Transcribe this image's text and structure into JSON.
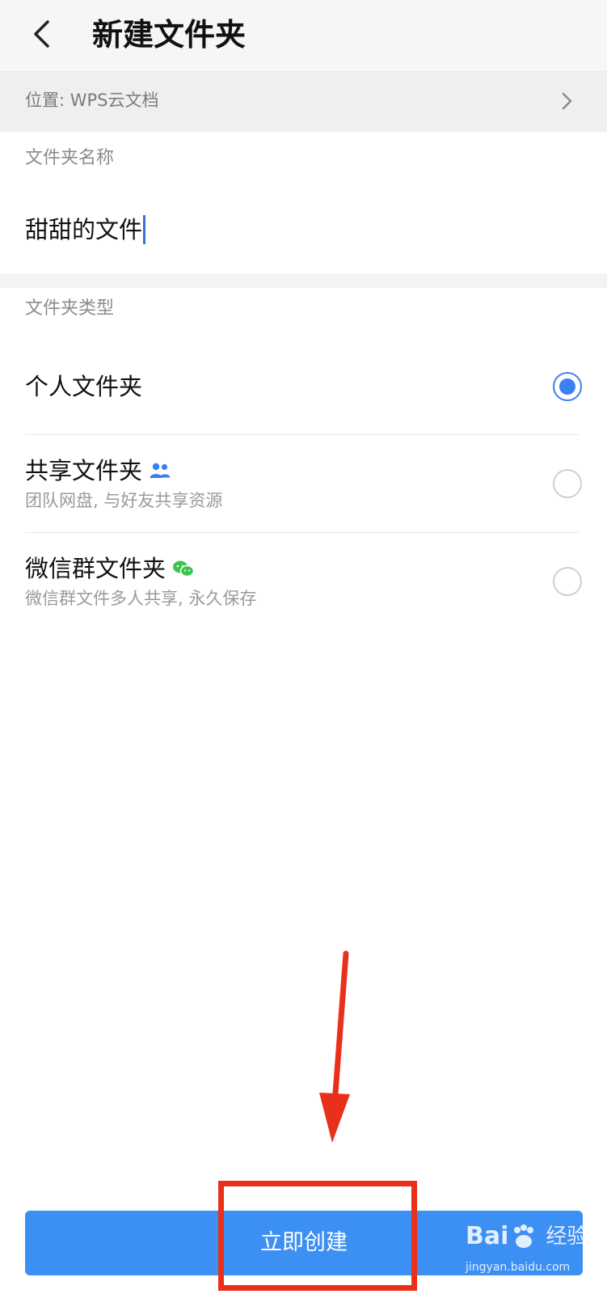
{
  "header": {
    "title": "新建文件夹"
  },
  "location": {
    "text": "位置: WPS云文档"
  },
  "name_section": {
    "label": "文件夹名称",
    "value": "甜甜的文件"
  },
  "type_section": {
    "label": "文件夹类型",
    "options": [
      {
        "title": "个人文件夹",
        "subtitle": "",
        "selected": true
      },
      {
        "title": "共享文件夹",
        "subtitle": "团队网盘, 与好友共享资源",
        "selected": false,
        "icon": "people-icon"
      },
      {
        "title": "微信群文件夹",
        "subtitle": "微信群文件多人共享, 永久保存",
        "selected": false,
        "icon": "wechat-icon"
      }
    ]
  },
  "action": {
    "create_label": "立即创建"
  },
  "watermark": {
    "brand_left": "Bai",
    "brand_right": "经验",
    "url": "jingyan.baidu.com"
  },
  "colors": {
    "accent": "#3c8ff3",
    "annotation": "#e8301b",
    "wechat_green": "#3cc34a",
    "people_blue": "#3b7ff4"
  }
}
